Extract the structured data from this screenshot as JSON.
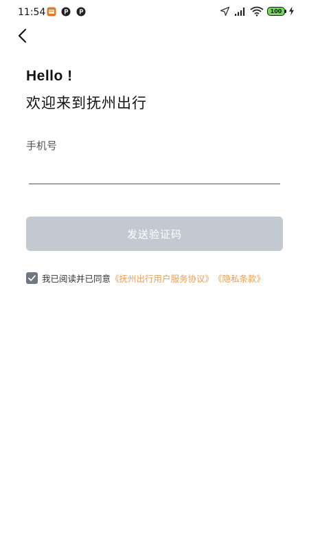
{
  "status_bar": {
    "time": "11:54",
    "battery": "100",
    "notification_icons": [
      "app-notification-icon",
      "p-notification-icon",
      "p-notification-icon"
    ],
    "system_icons": [
      "navigation-arrow-icon",
      "signal-icon",
      "wifi-icon",
      "battery-icon",
      "charging-icon"
    ]
  },
  "header": {
    "back_icon": "chevron-left-icon"
  },
  "greeting": {
    "hello": "Hello !",
    "welcome": "欢迎来到抚州出行"
  },
  "form": {
    "phone_label": "手机号",
    "phone_value": "",
    "send_code_label": "发送验证码"
  },
  "agreement": {
    "checked": true,
    "text": "我已阅读并已同意",
    "user_agreement_link": "《抚州出行用户服务协议》",
    "privacy_link": "《隐私条款》"
  },
  "colors": {
    "button_disabled": "#c3c9d1",
    "link": "#e3a058",
    "checkbox": "#6e7883"
  }
}
